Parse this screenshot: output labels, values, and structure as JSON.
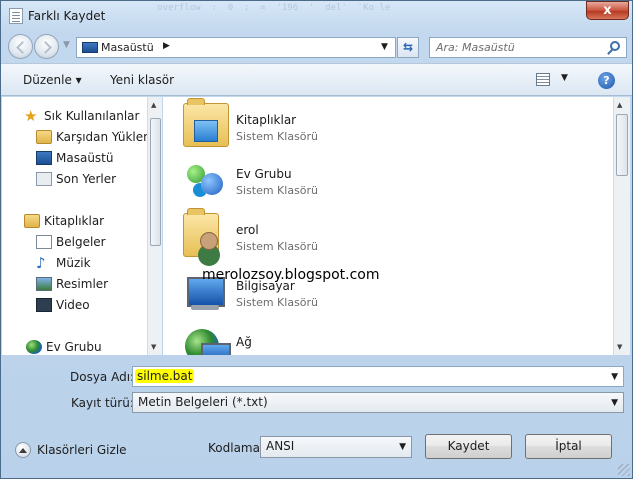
{
  "window": {
    "title": "Farklı Kaydet",
    "close_symbol": "x",
    "background_ghost_text": "   overflow  :  0  ;  =  '196  '  del'  `Ko le"
  },
  "nav": {
    "address": "Masaüstü",
    "search_placeholder": "Ara: Masaüstü"
  },
  "toolbar": {
    "organize": "Düzenle  ▾",
    "new_folder": "Yeni klasör",
    "help": "?"
  },
  "navpane": {
    "items": [
      {
        "label": "Sık Kullanılanlar",
        "icon": "star-icon"
      },
      {
        "label": "Karşıdan Yüklemeler",
        "icon": "download-folder-icon"
      },
      {
        "label": "Masaüstü",
        "icon": "desktop-icon"
      },
      {
        "label": "Son Yerler",
        "icon": "recent-places-icon"
      },
      {
        "label": "Kitaplıklar",
        "icon": "libraries-icon"
      },
      {
        "label": "Belgeler",
        "icon": "documents-icon"
      },
      {
        "label": "Müzik",
        "icon": "music-icon"
      },
      {
        "label": "Resimler",
        "icon": "pictures-icon"
      },
      {
        "label": "Video",
        "icon": "video-icon"
      },
      {
        "label": "Ev Grubu",
        "icon": "homegroup-icon"
      }
    ]
  },
  "content": {
    "items": [
      {
        "name": "Kitaplıklar",
        "type": "Sistem Klasörü",
        "icon": "libraries-folder-icon"
      },
      {
        "name": "Ev Grubu",
        "type": "Sistem Klasörü",
        "icon": "homegroup-icon"
      },
      {
        "name": "erol",
        "type": "Sistem Klasörü",
        "icon": "user-folder-icon"
      },
      {
        "name": "Bilgisayar",
        "type": "Sistem Klasörü",
        "icon": "computer-icon"
      },
      {
        "name": "Ağ",
        "type": "",
        "icon": "network-icon"
      }
    ],
    "watermark": "merolozsoy.blogspot.com"
  },
  "form": {
    "filename_label": "Dosya Adı:",
    "filename_value": "silme.bat",
    "filetype_label": "Kayıt türü:",
    "filetype_value": "Metin Belgeleri (*.txt)",
    "hide_folders": "Klasörleri Gizle",
    "encoding_label": "Kodlama:",
    "encoding_value": "ANSI",
    "save_button": "Kaydet",
    "cancel_button": "İptal"
  },
  "colors": {
    "highlight": "#ffff00",
    "accent": "#1d56a8"
  }
}
